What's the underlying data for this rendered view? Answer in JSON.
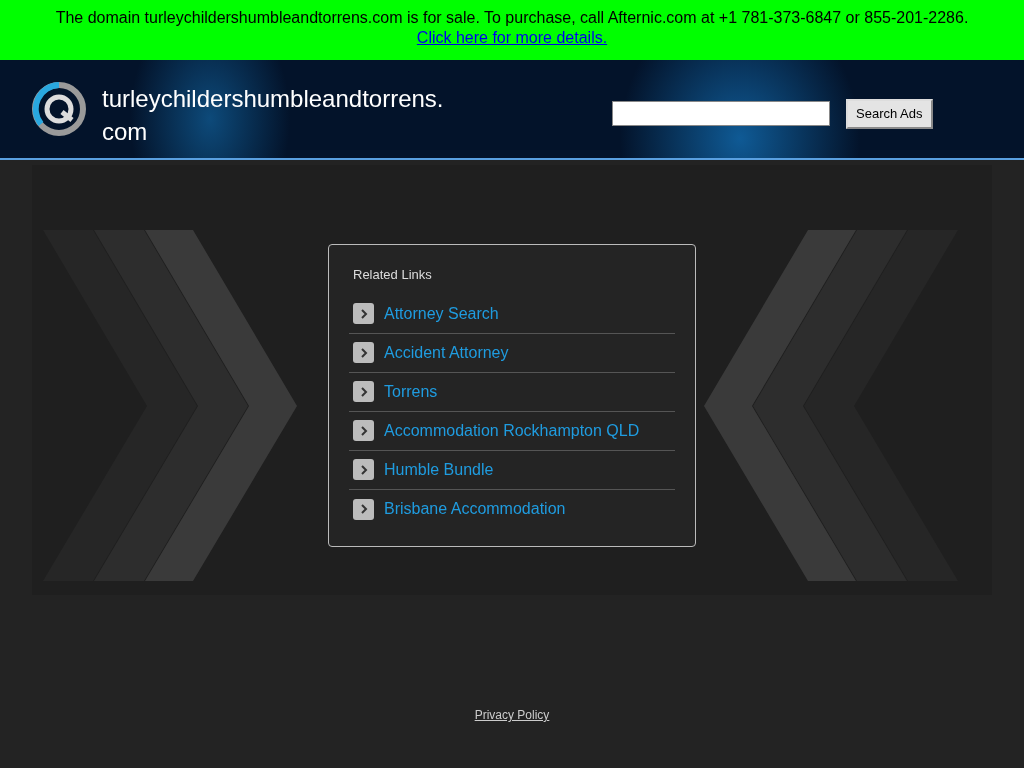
{
  "sale_banner": {
    "text": "The domain turleychildershumbleandtorrens.com is for sale. To purchase, call Afternic.com at +1 781-373-6847 or 855-201-2286.",
    "link": "Click here for more details."
  },
  "header": {
    "site_title": "turleychildershumbleandtorrens.com",
    "search_button": "Search Ads"
  },
  "related_links": {
    "title": "Related Links",
    "items": [
      {
        "label": "Attorney Search"
      },
      {
        "label": "Accident Attorney"
      },
      {
        "label": "Torrens"
      },
      {
        "label": "Accommodation Rockhampton QLD"
      },
      {
        "label": "Humble Bundle"
      },
      {
        "label": "Brisbane Accommodation"
      }
    ]
  },
  "footer": {
    "privacy_link": "Privacy Policy"
  }
}
